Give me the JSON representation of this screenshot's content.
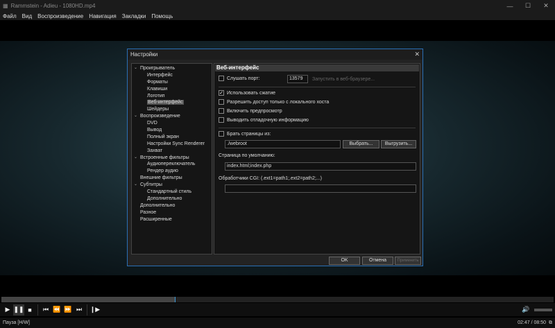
{
  "window": {
    "title": "Rammstein - Adieu - 1080HD.mp4"
  },
  "menu": [
    "Файл",
    "Вид",
    "Воспроизведение",
    "Навигация",
    "Закладки",
    "Помощь"
  ],
  "dialog": {
    "title": "Настройки",
    "tree": [
      {
        "label": "Проигрыватель",
        "level": 0
      },
      {
        "label": "Интерфейс",
        "level": 1
      },
      {
        "label": "Форматы",
        "level": 1
      },
      {
        "label": "Клавиши",
        "level": 1
      },
      {
        "label": "Логотип",
        "level": 1
      },
      {
        "label": "Веб-интерфейс",
        "level": 1,
        "selected": true
      },
      {
        "label": "Шейдеры",
        "level": 1
      },
      {
        "label": "Воспроизведение",
        "level": 0
      },
      {
        "label": "DVD",
        "level": 1
      },
      {
        "label": "Вывод",
        "level": 1
      },
      {
        "label": "Полный экран",
        "level": 1
      },
      {
        "label": "Настройки Sync Renderer",
        "level": 1
      },
      {
        "label": "Захват",
        "level": 1
      },
      {
        "label": "Встроенные фильтры",
        "level": 0
      },
      {
        "label": "Аудиопереключатель",
        "level": 1
      },
      {
        "label": "Рендер аудио",
        "level": 1
      },
      {
        "label": "Внешние фильтры",
        "level": 0,
        "leaf": true
      },
      {
        "label": "Субтитры",
        "level": 0
      },
      {
        "label": "Стандартный стиль",
        "level": 1
      },
      {
        "label": "Дополнительно",
        "level": 1
      },
      {
        "label": "Дополнительно",
        "level": 0,
        "leaf": true
      },
      {
        "label": "Разное",
        "level": 0,
        "leaf": true
      },
      {
        "label": "Расширенные",
        "level": 0,
        "leaf": true
      }
    ],
    "panel": {
      "heading": "Веб-интерфейс",
      "listen_port": {
        "label": "Слушать порт:",
        "checked": false,
        "value": "13579"
      },
      "launch_browser": "Запустить в веб-браузере...",
      "use_compression": {
        "label": "Использовать сжатие",
        "checked": true
      },
      "local_only": {
        "label": "Разрешить доступ только с локального хоста",
        "checked": false
      },
      "preview": {
        "label": "Включить предпросмотр",
        "checked": false
      },
      "debug": {
        "label": "Выводить отладочную информацию",
        "checked": false
      },
      "serve_pages": {
        "label": "Брать страницы из:",
        "checked": false,
        "value": "./webroot"
      },
      "browse": "Выбрать...",
      "export": "Выгрузить...",
      "default_page_label": "Страница по умолчанию:",
      "default_page": "index.html;index.php",
      "cgi_label": "Обработчики CGI: (.ext1=path1;.ext2=path2;...)",
      "cgi": ""
    },
    "buttons": {
      "ok": "OK",
      "cancel": "Отмена",
      "apply": "Применить"
    }
  },
  "player": {
    "progress": 0.315,
    "status": "Пауза [H/W]",
    "time": "02:47 / 08:50"
  }
}
